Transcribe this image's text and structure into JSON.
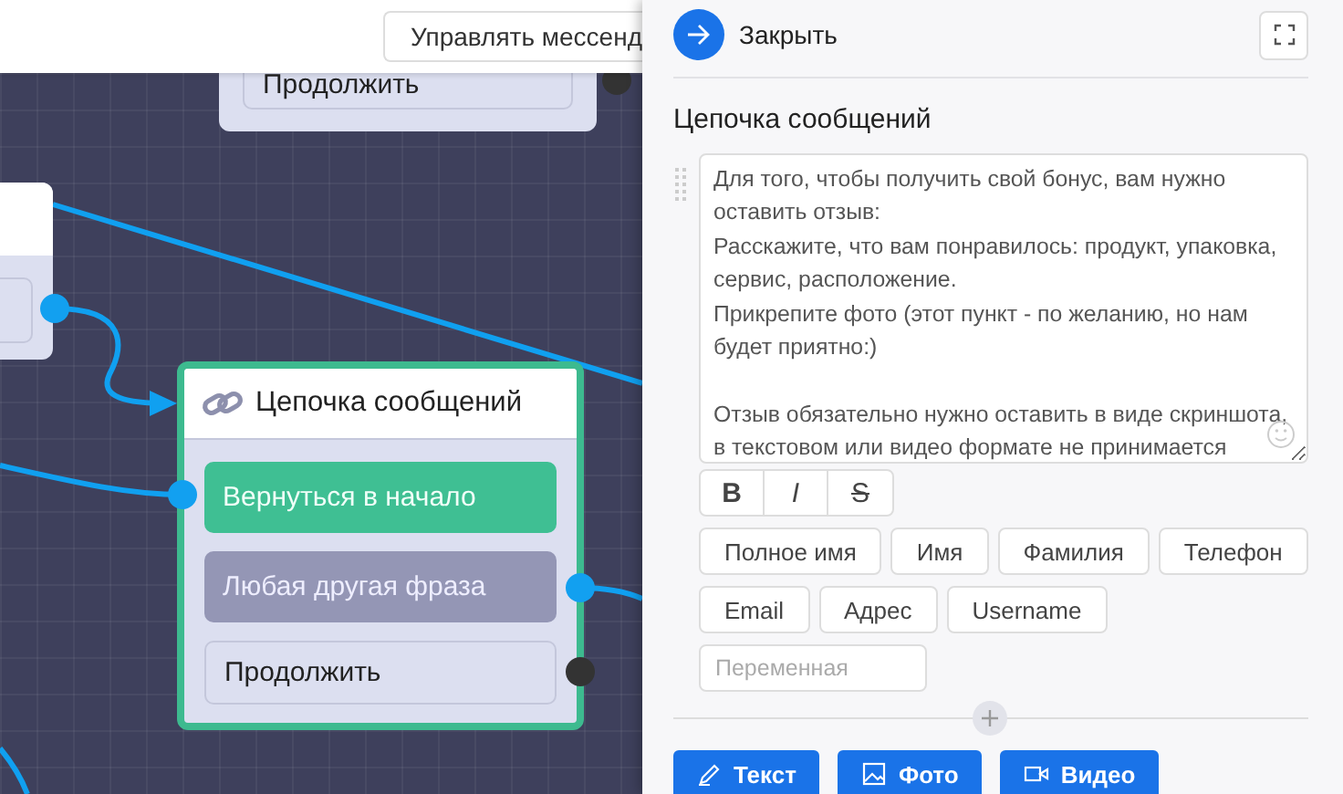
{
  "top_bar": {
    "manage_button": "Управлять мессенд"
  },
  "canvas": {
    "top_node": {
      "button": "Продолжить"
    },
    "chain_node": {
      "title": "Цепочка сообщений",
      "selected": true,
      "buttons": [
        {
          "label": "Вернуться в начало",
          "kind": "green"
        },
        {
          "label": "Любая другая фраза",
          "kind": "gray"
        },
        {
          "label": "Продолжить",
          "kind": "default"
        }
      ]
    }
  },
  "panel": {
    "close_button": "Закрыть",
    "title": "Цепочка сообщений",
    "message": {
      "value": "Для того, чтобы получить свой бонус, вам нужно оставить отзыв:\nРасскажите, что вам понравилось: продукт, упаковка, сервис, расположение.\nПрикрепите фото (этот пункт - по желанию, но нам будет приятно:)\n\nОтзыв обязательно нужно оставить в виде скриншота, в текстовом или видео формате не принимается"
    },
    "format_buttons": [
      {
        "label": "B",
        "kind": "bold"
      },
      {
        "label": "I",
        "kind": "italic"
      },
      {
        "label": "S",
        "kind": "strike"
      }
    ],
    "variables": [
      [
        "Полное имя",
        "Имя",
        "Фамилия",
        "Телефон"
      ],
      [
        "Email",
        "Адрес",
        "Username"
      ]
    ],
    "variable_field": {
      "placeholder": "Переменная"
    },
    "add_buttons": [
      {
        "label": "Текст",
        "kind": "text"
      },
      {
        "label": "Фото",
        "kind": "photo"
      },
      {
        "label": "Видео",
        "kind": "video"
      }
    ]
  }
}
